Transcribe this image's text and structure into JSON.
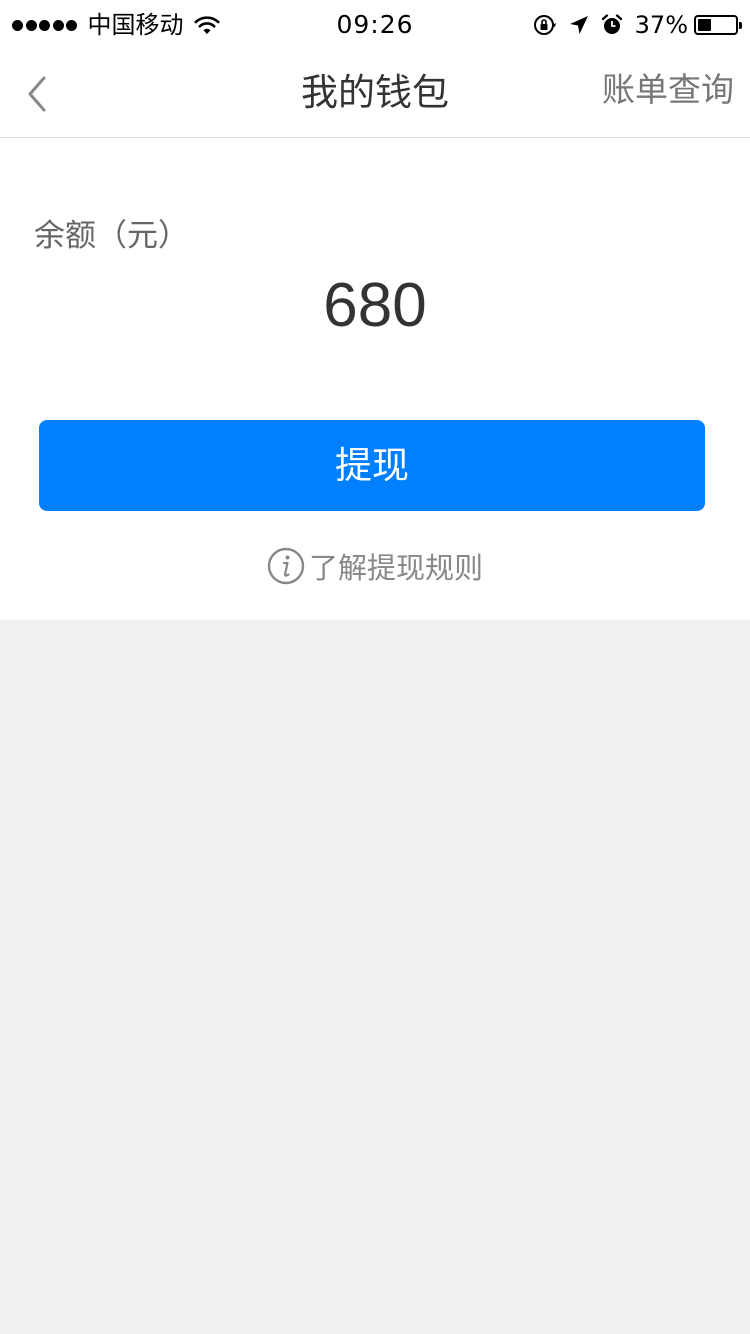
{
  "status_bar": {
    "carrier": "中国移动",
    "time": "09:26",
    "battery_percent": "37%",
    "battery_level": 0.37,
    "signal_bars": 5
  },
  "nav": {
    "title": "我的钱包",
    "action_label": "账单查询",
    "back_icon": "chevron-left-icon"
  },
  "wallet": {
    "balance_label": "余额（元）",
    "balance_value": "680",
    "withdraw_label": "提现",
    "rules_label": "了解提现规则",
    "rules_icon": "info-icon"
  },
  "colors": {
    "primary": "#0080ff",
    "page_background": "#f0f0f0"
  }
}
